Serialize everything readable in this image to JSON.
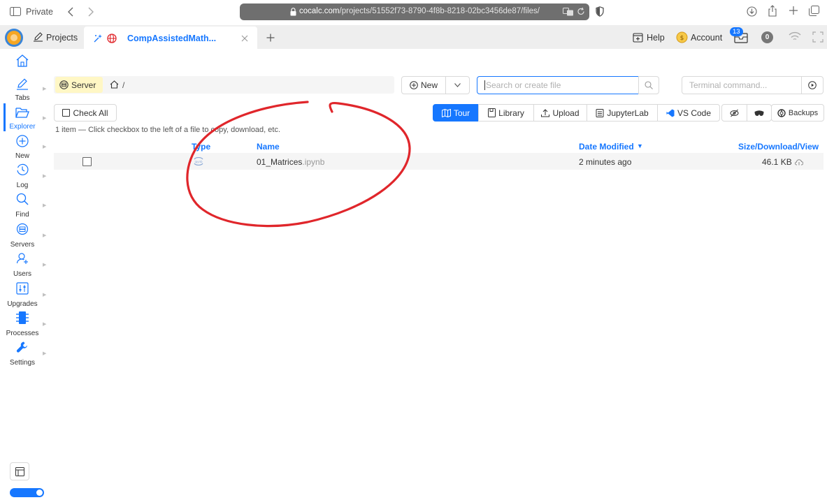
{
  "browser": {
    "private_label": "Private",
    "url_host": "cocalc.com",
    "url_path": "/projects/51552f73-8790-4f8b-8218-02bc3456de87/files/"
  },
  "topbar": {
    "projects_label": "Projects",
    "project_tab_title": "CompAssistedMath...",
    "help_label": "Help",
    "account_label": "Account",
    "notifications_count": "13",
    "status_count": "0"
  },
  "sidebar": {
    "items": [
      {
        "label": "Tabs"
      },
      {
        "label": "Explorer"
      },
      {
        "label": "New"
      },
      {
        "label": "Log"
      },
      {
        "label": "Find"
      },
      {
        "label": "Servers"
      },
      {
        "label": "Users"
      },
      {
        "label": "Upgrades"
      },
      {
        "label": "Processes"
      },
      {
        "label": "Settings"
      }
    ]
  },
  "explorer": {
    "server_label": "Server",
    "path": "/",
    "new_label": "New",
    "search_placeholder": "Search or create file",
    "terminal_placeholder": "Terminal command...",
    "check_all_label": "Check All",
    "hint": "1 item — Click checkbox to the left of a file to copy, download, etc.",
    "tour_label": "Tour",
    "library_label": "Library",
    "upload_label": "Upload",
    "jupyterlab_label": "JupyterLab",
    "vscode_label": "VS Code",
    "backups_label": "Backups",
    "columns": {
      "type": "Type",
      "name": "Name",
      "date": "Date Modified",
      "size": "Size/Download/View"
    },
    "files": [
      {
        "name_base": "01_Matrices",
        "name_ext": ".ipynb",
        "modified": "2 minutes ago",
        "size": "46.1 KB"
      }
    ]
  },
  "colors": {
    "accent": "#1677ff",
    "annotation": "#e0262b",
    "row_background": "#f5f5f5"
  }
}
